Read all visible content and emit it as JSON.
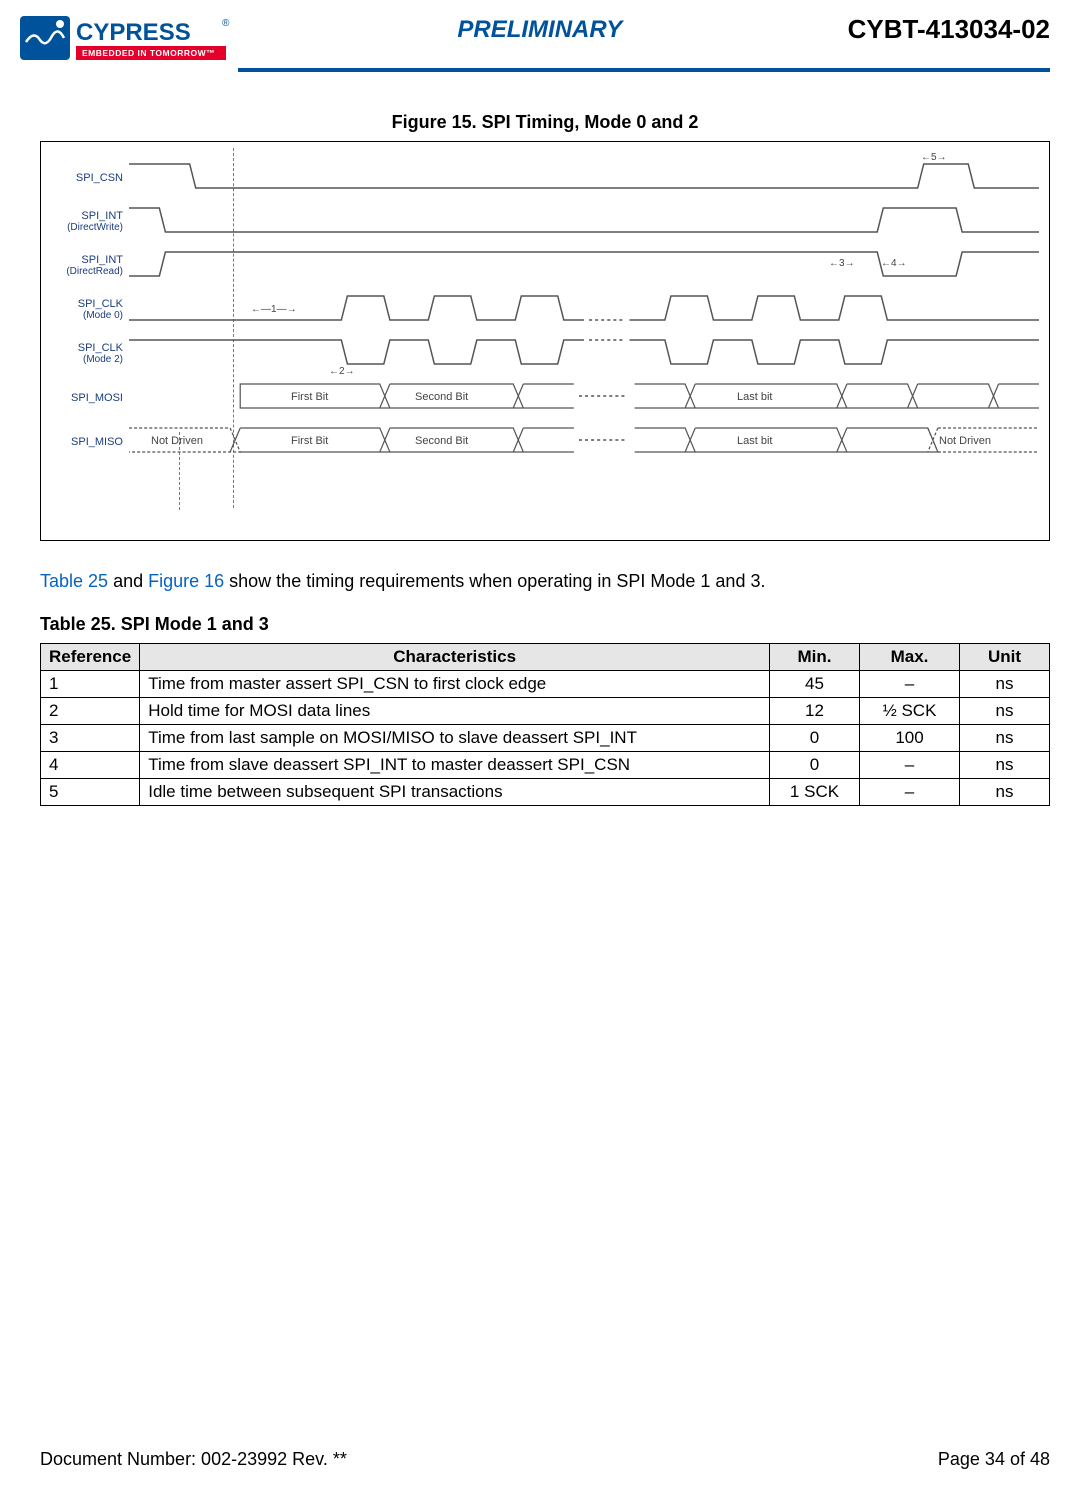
{
  "header": {
    "preliminary": "PRELIMINARY",
    "part_number": "CYBT-413034-02",
    "logo_main": "CYPRESS",
    "logo_tag": "EMBEDDED IN TOMORROW™"
  },
  "figure": {
    "caption": "Figure 15.  SPI Timing, Mode 0 and 2",
    "signals": {
      "csn": {
        "label": "SPI_CSN",
        "sub": ""
      },
      "int_dw": {
        "label": "SPI_INT",
        "sub": "(DirectWrite)"
      },
      "int_dr": {
        "label": "SPI_INT",
        "sub": "(DirectRead)"
      },
      "clk0": {
        "label": "SPI_CLK",
        "sub": "(Mode 0)"
      },
      "clk2": {
        "label": "SPI_CLK",
        "sub": "(Mode 2)"
      },
      "mosi": {
        "label": "SPI_MOSI",
        "sub": ""
      },
      "miso": {
        "label": "SPI_MISO",
        "sub": ""
      }
    },
    "markers": {
      "m1": "1",
      "m2": "2",
      "m3": "3",
      "m4": "4",
      "m5": "5"
    },
    "bits": {
      "first": "First Bit",
      "second": "Second Bit",
      "last": "Last bit",
      "not_driven": "Not Driven"
    }
  },
  "paragraph": {
    "link1": "Table 25",
    "mid1": " and ",
    "link2": "Figure 16",
    "mid2": " show the timing requirements when operating in SPI Mode 1 and 3."
  },
  "table": {
    "caption": "Table 25.  SPI Mode 1 and 3",
    "headers": {
      "ref": "Reference",
      "char": "Characteristics",
      "min": "Min.",
      "max": "Max.",
      "unit": "Unit"
    },
    "rows": [
      {
        "ref": "1",
        "char": "Time from master assert SPI_CSN to first clock edge",
        "min": "45",
        "max": "–",
        "unit": "ns"
      },
      {
        "ref": "2",
        "char": "Hold time for MOSI data lines",
        "min": "12",
        "max": "½ SCK",
        "unit": "ns"
      },
      {
        "ref": "3",
        "char": "Time from last sample on MOSI/MISO to slave deassert SPI_INT",
        "min": "0",
        "max": "100",
        "unit": "ns"
      },
      {
        "ref": "4",
        "char": "Time from slave deassert SPI_INT to master deassert SPI_CSN",
        "min": "0",
        "max": "–",
        "unit": "ns"
      },
      {
        "ref": "5",
        "char": "Idle time between subsequent SPI transactions",
        "min": "1 SCK",
        "max": "–",
        "unit": "ns"
      }
    ]
  },
  "footer": {
    "doc": "Document Number: 002-23992 Rev. **",
    "page": "Page 34 of 48"
  }
}
